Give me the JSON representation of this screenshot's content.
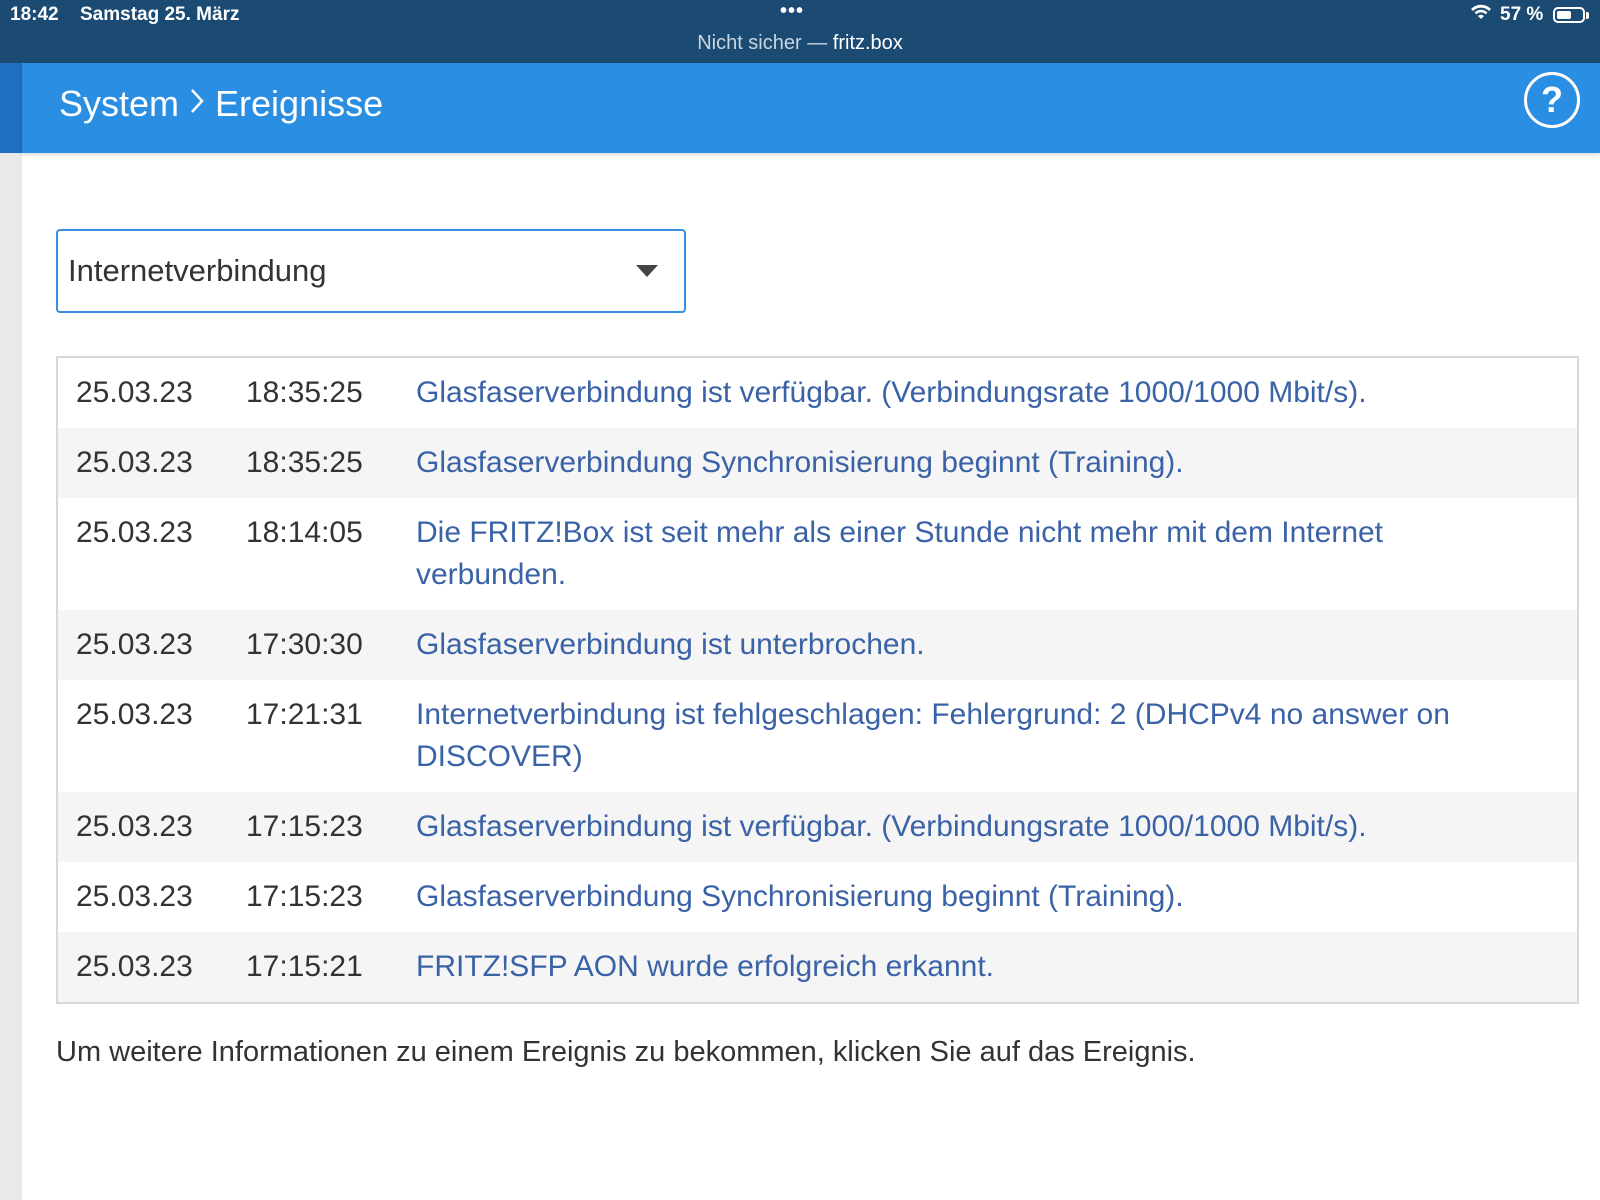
{
  "status_bar": {
    "time": "18:42",
    "date": "Samstag 25. März",
    "dots": "•••",
    "url_prefix": "Nicht sicher — ",
    "url_host": "fritz.box",
    "battery_text": "57 %",
    "battery_level": 0.57
  },
  "header": {
    "crumb_1": "System",
    "separator": "›",
    "crumb_2": "Ereignisse",
    "help_label": "?"
  },
  "filter": {
    "selected": "Internetverbindung"
  },
  "events": [
    {
      "date": "25.03.23",
      "time": "18:35:25",
      "message": "Glasfaserverbindung ist verfügbar. (Verbindungsrate 1000/1000 Mbit/s)."
    },
    {
      "date": "25.03.23",
      "time": "18:35:25",
      "message": "Glasfaserverbindung Synchronisierung beginnt (Training)."
    },
    {
      "date": "25.03.23",
      "time": "18:14:05",
      "message": "Die FRITZ!Box ist seit mehr als einer Stunde nicht mehr mit dem Internet verbunden."
    },
    {
      "date": "25.03.23",
      "time": "17:30:30",
      "message": "Glasfaserverbindung ist unterbrochen."
    },
    {
      "date": "25.03.23",
      "time": "17:21:31",
      "message": "Internetverbindung ist fehlgeschlagen: Fehlergrund: 2 (DHCPv4 no answer on DISCOVER)"
    },
    {
      "date": "25.03.23",
      "time": "17:15:23",
      "message": "Glasfaserverbindung ist verfügbar. (Verbindungsrate 1000/1000 Mbit/s)."
    },
    {
      "date": "25.03.23",
      "time": "17:15:23",
      "message": "Glasfaserverbindung Synchronisierung beginnt (Training)."
    },
    {
      "date": "25.03.23",
      "time": "17:15:21",
      "message": "FRITZ!SFP AON wurde erfolgreich erkannt."
    }
  ],
  "footnote": "Um weitere Informationen zu einem Ereignis zu bekommen, klicken Sie auf das Ereignis.",
  "colors": {
    "status_bar": "#1b4a72",
    "header": "#2a8ee2",
    "link": "#3a62a6",
    "dropdown_border": "#3a8ee0"
  }
}
